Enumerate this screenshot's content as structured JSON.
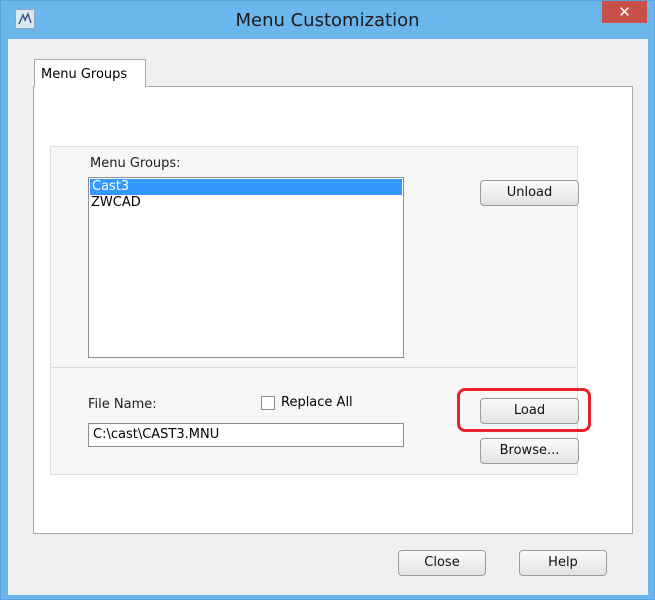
{
  "window": {
    "title": "Menu Customization",
    "close_glyph": "✕"
  },
  "tabs": [
    {
      "label": "Menu Groups"
    }
  ],
  "menu_groups": {
    "label": "Menu Groups:",
    "items": [
      "Cast3",
      "ZWCAD"
    ],
    "selected_item": "Cast3",
    "unload_label": "Unload"
  },
  "file": {
    "label": "File Name:",
    "value": "C:\\cast\\CAST3.MNU",
    "replace_all_label": "Replace All",
    "replace_all_checked": false,
    "load_label": "Load",
    "browse_label": "Browse..."
  },
  "footer": {
    "close_label": "Close",
    "help_label": "Help"
  },
  "icons": {
    "app": "app-logo-icon",
    "close": "close-icon"
  },
  "colors": {
    "titlebar": "#6cb6ee",
    "selection": "#3399ff",
    "highlight": "#e8212b",
    "close_button": "#c7504b"
  }
}
